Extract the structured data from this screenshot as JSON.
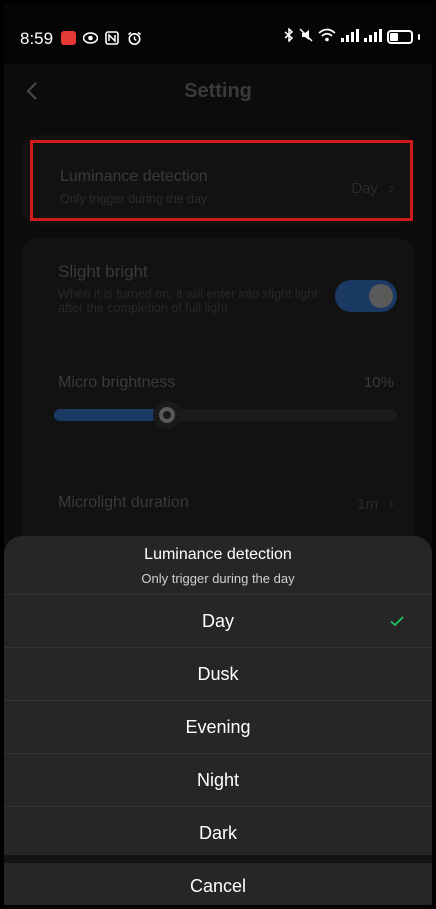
{
  "status_bar": {
    "time": "8:59",
    "left_icons": [
      "record-icon",
      "eye-icon",
      "nfc-icon",
      "alarm-icon"
    ],
    "right_icons": [
      "bluetooth-icon",
      "mute-icon",
      "wifi-icon",
      "signal-icon",
      "signal-icon",
      "battery-icon"
    ]
  },
  "header": {
    "title": "Setting",
    "back_icon": "chevron-left-icon"
  },
  "luminance_row": {
    "title": "Luminance detection",
    "subtitle": "Only trigger during the day",
    "value": "Day",
    "highlight_color": "#d11a1a"
  },
  "slight_bright": {
    "title": "Slight bright",
    "description": "When it is turned on, it will enter into slight light after the completion of full light",
    "toggle_on": true
  },
  "micro_brightness": {
    "title": "Micro brightness",
    "value": "10%",
    "slider_fraction": 0.33
  },
  "microlight_duration": {
    "title": "Microlight duration",
    "value": "1m"
  },
  "sheet": {
    "title": "Luminance detection",
    "subtitle": "Only trigger during the day",
    "options": [
      {
        "label": "Day",
        "selected": true
      },
      {
        "label": "Dusk",
        "selected": false
      },
      {
        "label": "Evening",
        "selected": false
      },
      {
        "label": "Night",
        "selected": false
      },
      {
        "label": "Dark",
        "selected": false
      }
    ],
    "cancel_label": "Cancel",
    "accent_color": "#22c55e"
  }
}
